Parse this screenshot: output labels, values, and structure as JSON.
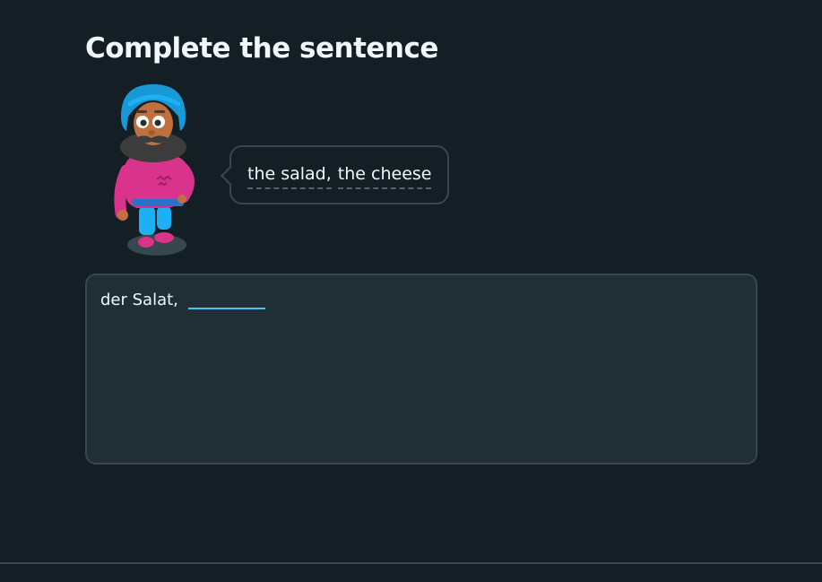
{
  "header": {
    "title": "Complete the sentence"
  },
  "character": {
    "icon": "character-illustration-icon"
  },
  "speech_bubble": {
    "words": [
      "the salad,",
      "the cheese"
    ]
  },
  "answer": {
    "prefix_text": "der Salat,",
    "input_value": "",
    "input_placeholder": ""
  },
  "colors": {
    "background": "#131f24",
    "panel": "#202f36",
    "border": "#37464f",
    "input_underline": "#49c0f8",
    "text": "#f1f7fb"
  }
}
